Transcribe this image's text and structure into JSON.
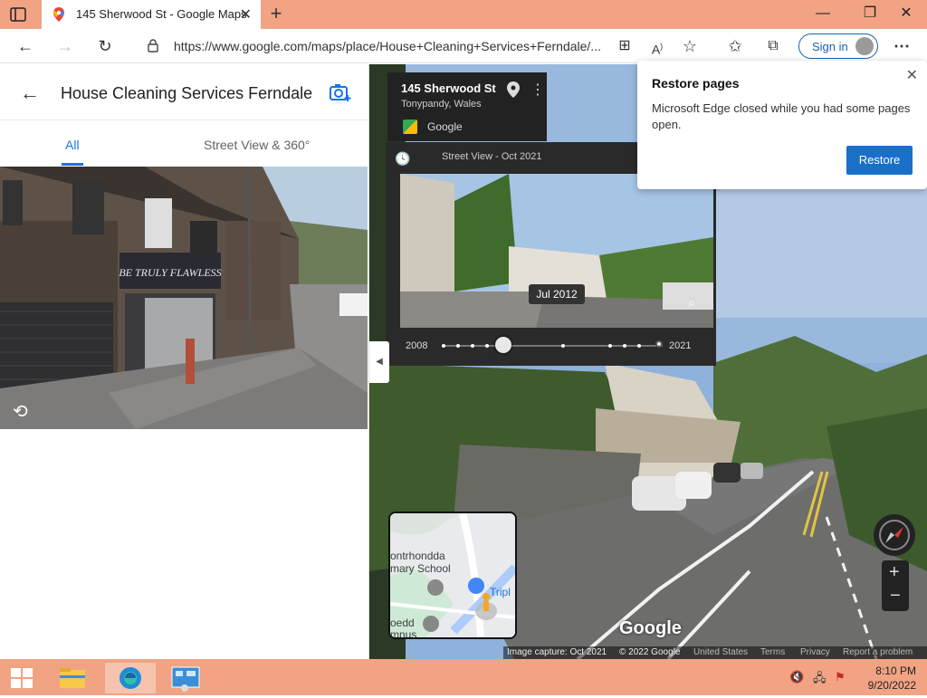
{
  "browser": {
    "tab_title": "145 Sherwood St - Google Maps",
    "url": "https://www.google.com/maps/place/House+Cleaning+Services+Ferndale/...",
    "signin_label": "Sign in"
  },
  "left_panel": {
    "title": "House Cleaning Services Ferndale",
    "tabs": [
      {
        "label": "All",
        "active": true
      },
      {
        "label": "Street View & 360°",
        "active": false
      }
    ],
    "shop_sign": "BE TRULY FLAWLESS"
  },
  "street_view": {
    "address": "145 Sherwood St",
    "locality": "Tonypandy, Wales",
    "source": "Google",
    "timeline_label": "Street View - Oct 2021",
    "selected_date": "Jul 2012",
    "year_start": "2008",
    "year_end": "2021",
    "timeline_position": 0.28
  },
  "minimap": {
    "label_school_1": "ontrhondda",
    "label_school_2": "mary School",
    "label_trip": "Tripl",
    "label_bottom_1": "oedd",
    "label_bottom_2": "mnus"
  },
  "map_footer": {
    "logo": "Google",
    "capture": "Image capture: Oct 2021",
    "copyright": "© 2022 Google",
    "country": "United States",
    "terms": "Terms",
    "privacy": "Privacy",
    "report": "Report a problem"
  },
  "popup": {
    "title": "Restore pages",
    "body": "Microsoft Edge closed while you had some pages open.",
    "button": "Restore"
  },
  "taskbar": {
    "time": "8:10 PM",
    "date": "9/20/2022"
  },
  "colors": {
    "titlebar": "#f1a384",
    "accent_blue": "#1a73e8",
    "restore_button": "#1a6fc9"
  }
}
